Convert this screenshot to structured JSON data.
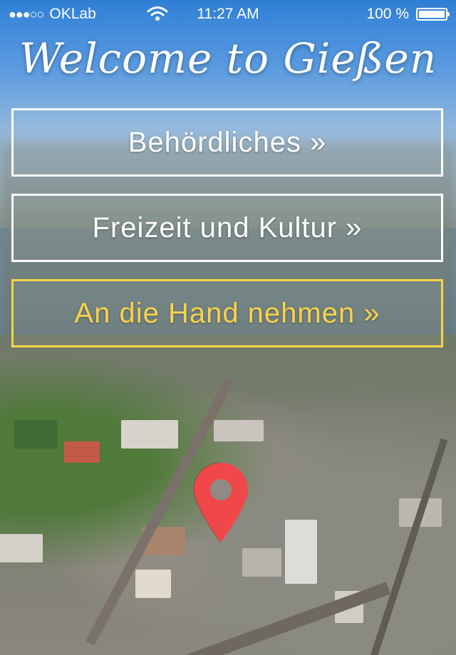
{
  "status_bar": {
    "signal_dots": "●●●○○",
    "carrier": "OKLab",
    "time": "11:27 AM",
    "battery_percent": "100 %",
    "icons": [
      "wifi-icon",
      "battery-icon"
    ]
  },
  "header": {
    "title": "Welcome to Gießen"
  },
  "menu": {
    "items": [
      {
        "label": "Behördliches »",
        "color": "#ffffff"
      },
      {
        "label": "Freizeit und Kultur »",
        "color": "#ffffff"
      },
      {
        "label": "An die Hand nehmen »",
        "color": "#f7d34a"
      }
    ]
  },
  "map": {
    "pin_icon": "location-pin-icon",
    "pin_color": "#f0484a"
  }
}
